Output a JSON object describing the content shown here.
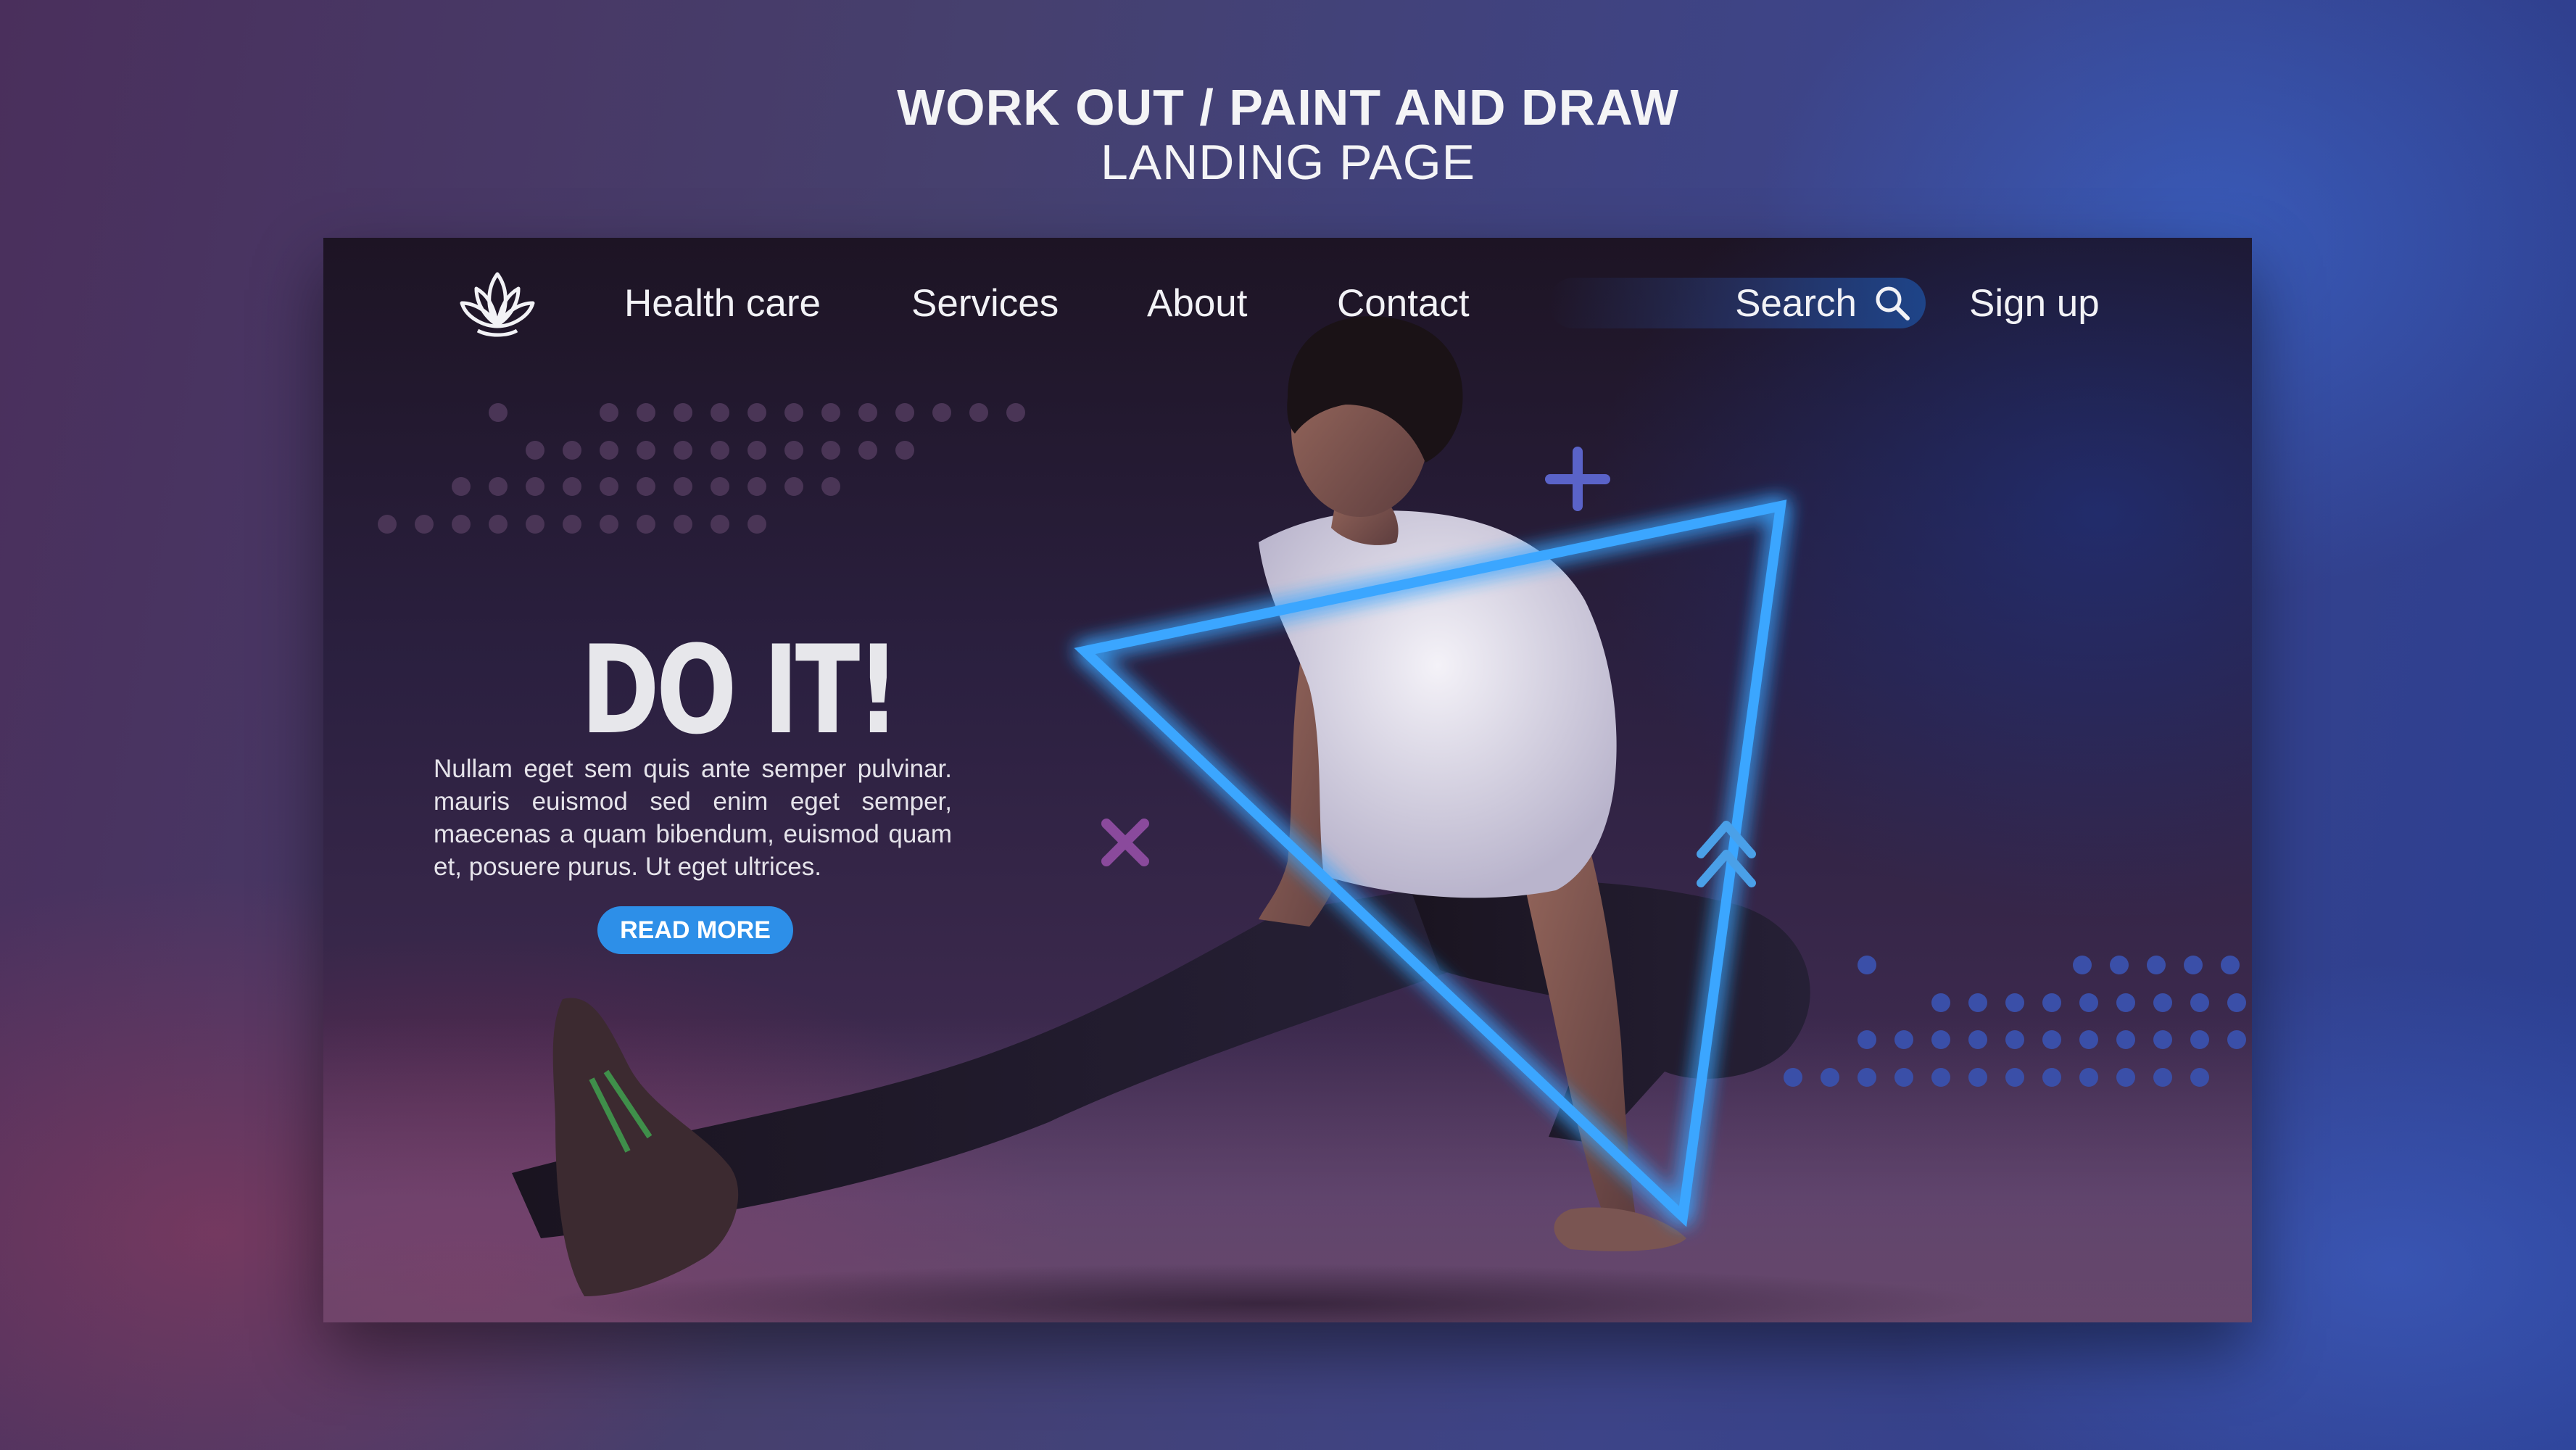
{
  "banner": {
    "line1": "WORK OUT / PAINT AND DRAW",
    "line2": "LANDING PAGE"
  },
  "nav": {
    "logo_icon": "lotus-icon",
    "links": [
      "Health care",
      "Services",
      "About",
      "Contact"
    ],
    "search_label": "Search",
    "search_icon": "search-icon",
    "signup_label": "Sign up"
  },
  "hero": {
    "title": "DO IT!",
    "body": "Nullam eget sem quis ante semper pulvinar. mauris euismod sed enim eget semper, maecenas a quam bibendum, euismod quam et, posuere purus. Ut eget ultrices.",
    "button_label": "READ MORE"
  },
  "colors": {
    "accent": "#2d8fe8",
    "neon": "#3aa6ff",
    "dots_left": "#4a3556",
    "dots_right": "#3a4fa8"
  }
}
